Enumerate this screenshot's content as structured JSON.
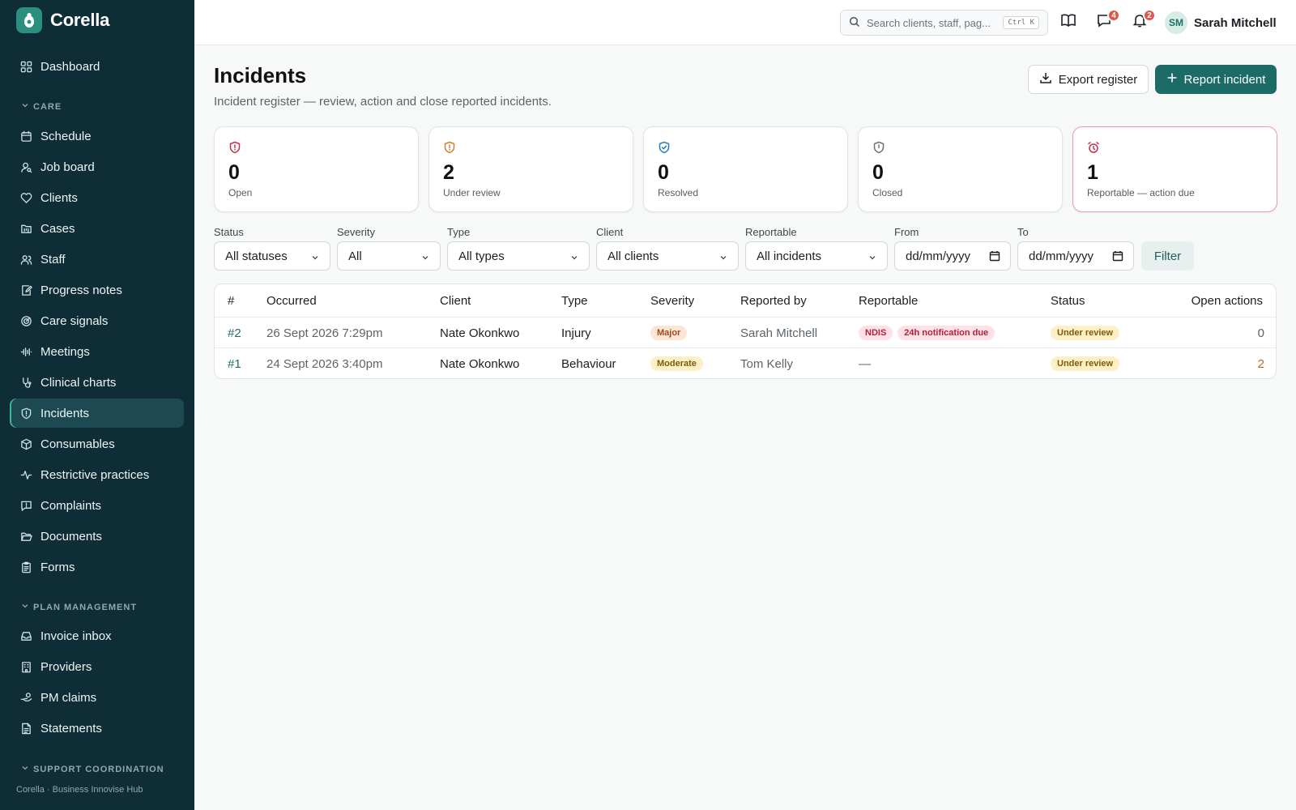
{
  "app": {
    "name": "Corella",
    "footer": "Corella · Business Innovise Hub"
  },
  "sidebar": {
    "dashboard": "Dashboard",
    "sections": [
      {
        "label": "CARE"
      },
      {
        "label": "PLAN MANAGEMENT"
      },
      {
        "label": "SUPPORT COORDINATION"
      }
    ],
    "care_items": [
      {
        "label": "Schedule",
        "icon": "calendar-icon"
      },
      {
        "label": "Job board",
        "icon": "user-search-icon"
      },
      {
        "label": "Clients",
        "icon": "heart-handshake-icon"
      },
      {
        "label": "Cases",
        "icon": "folder-kanban-icon"
      },
      {
        "label": "Staff",
        "icon": "users-icon"
      },
      {
        "label": "Progress notes",
        "icon": "notebook-pen-icon"
      },
      {
        "label": "Care signals",
        "icon": "radar-icon"
      },
      {
        "label": "Meetings",
        "icon": "audio-waveform-icon"
      },
      {
        "label": "Clinical charts",
        "icon": "stethoscope-icon"
      },
      {
        "label": "Incidents",
        "icon": "shield-alert-icon",
        "active": true
      },
      {
        "label": "Consumables",
        "icon": "package-icon"
      },
      {
        "label": "Restrictive practices",
        "icon": "activity-icon"
      },
      {
        "label": "Complaints",
        "icon": "message-square-alert-icon"
      },
      {
        "label": "Documents",
        "icon": "folder-open-icon"
      },
      {
        "label": "Forms",
        "icon": "clipboard-list-icon"
      }
    ],
    "pm_items": [
      {
        "label": "Invoice inbox",
        "icon": "inbox-icon"
      },
      {
        "label": "Providers",
        "icon": "building-icon"
      },
      {
        "label": "PM claims",
        "icon": "hand-coins-icon"
      },
      {
        "label": "Statements",
        "icon": "file-text-icon"
      }
    ]
  },
  "topbar": {
    "search_placeholder": "Search clients, staff, pag...",
    "search_shortcut": "Ctrl K",
    "messages_count": "4",
    "notifications_count": "2",
    "user_initials": "SM",
    "user_name": "Sarah Mitchell"
  },
  "page": {
    "title": "Incidents",
    "subtitle": "Incident register — review, action and close reported incidents.",
    "export_label": "Export register",
    "report_label": "Report incident"
  },
  "stats": [
    {
      "value": "0",
      "label": "Open",
      "color": "#c0324e"
    },
    {
      "value": "2",
      "label": "Under review",
      "color": "#d0802a"
    },
    {
      "value": "0",
      "label": "Resolved",
      "color": "#2a7fb8"
    },
    {
      "value": "0",
      "label": "Closed",
      "color": "#6b7378"
    },
    {
      "value": "1",
      "label": "Reportable — action due",
      "color": "#c0324e"
    }
  ],
  "filters": {
    "status": {
      "label": "Status",
      "value": "All statuses"
    },
    "severity": {
      "label": "Severity",
      "value": "All"
    },
    "type": {
      "label": "Type",
      "value": "All types"
    },
    "client": {
      "label": "Client",
      "value": "All clients"
    },
    "reportable": {
      "label": "Reportable",
      "value": "All incidents"
    },
    "from": {
      "label": "From",
      "value": "dd/mm/yyyy"
    },
    "to": {
      "label": "To",
      "value": "dd/mm/yyyy"
    },
    "button": "Filter"
  },
  "table": {
    "headers": [
      "#",
      "Occurred",
      "Client",
      "Type",
      "Severity",
      "Reported by",
      "Reportable",
      "Status",
      "Open actions"
    ],
    "rows": [
      {
        "id": "#2",
        "occurred": "26 Sept 2026 7:29pm",
        "client": "Nate Okonkwo",
        "type": "Injury",
        "severity": "Major",
        "reported_by": "Sarah Mitchell",
        "reportable_tags": [
          "NDIS",
          "24h notification due"
        ],
        "status": "Under review",
        "open_actions": "0"
      },
      {
        "id": "#1",
        "occurred": "24 Sept 2026 3:40pm",
        "client": "Nate Okonkwo",
        "type": "Behaviour",
        "severity": "Moderate",
        "reported_by": "Tom Kelly",
        "reportable_dash": "—",
        "status": "Under review",
        "open_actions": "2"
      }
    ]
  }
}
